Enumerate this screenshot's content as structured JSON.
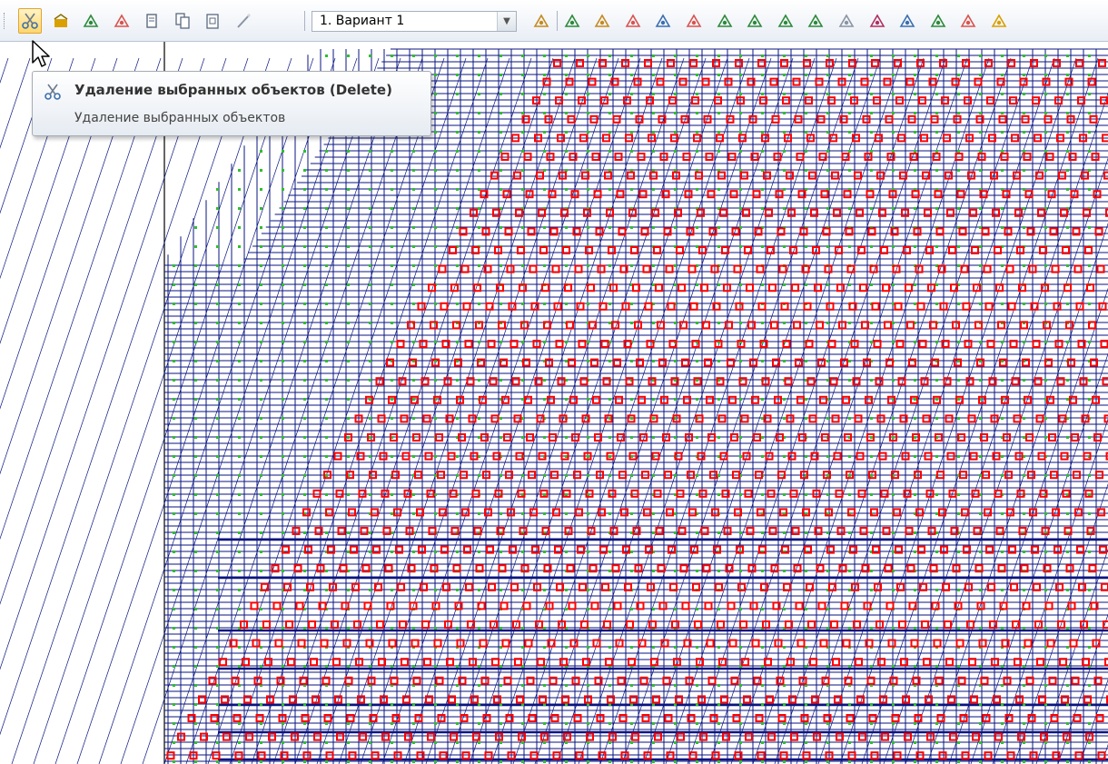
{
  "toolbar": {
    "left_buttons": [
      {
        "icon": "scissors-icon",
        "color": "#3a6fb0",
        "active": true
      },
      {
        "icon": "open-box-icon",
        "color": "#d9a000"
      },
      {
        "icon": "pin-nodes-icon",
        "color": "#2c8a3a"
      },
      {
        "icon": "add-node-icon",
        "color": "#d9534f"
      },
      {
        "icon": "copy-doc-icon",
        "color": "#5a6a80"
      },
      {
        "icon": "copy-docs-icon",
        "color": "#5a6a80"
      },
      {
        "icon": "paste-doc-icon",
        "color": "#5a6a80"
      },
      {
        "icon": "wand-icon",
        "color": "#8a94a3"
      }
    ],
    "variant_select": {
      "value": "1. Вариант 1"
    },
    "right_buttons": [
      {
        "icon": "hammer-icon",
        "color": "#c58a1f"
      },
      {
        "icon": "supports-icon",
        "color": "#2c8a3a"
      },
      {
        "icon": "loads-icon",
        "color": "#c58a1f"
      },
      {
        "icon": "spring-grid-icon",
        "color": "#d9534f"
      },
      {
        "icon": "table-icon",
        "color": "#3a6fb0"
      },
      {
        "icon": "eraser-icon",
        "color": "#d9534f"
      },
      {
        "icon": "rotate-axes-icon",
        "color": "#2c8a3a"
      },
      {
        "icon": "hatch-icon",
        "color": "#2c8a3a"
      },
      {
        "icon": "split-icon",
        "color": "#2c8a3a"
      },
      {
        "icon": "swirl-icon",
        "color": "#2c8a3a"
      },
      {
        "icon": "tool-icon",
        "color": "#8a94a3"
      },
      {
        "icon": "stack-icon",
        "color": "#b03060"
      },
      {
        "icon": "hinge-icon",
        "color": "#3a6fb0"
      },
      {
        "icon": "label-axes-icon",
        "color": "#2c8a3a"
      },
      {
        "icon": "frame-icon",
        "color": "#d9534f"
      },
      {
        "icon": "grid-color-icon",
        "color": "#d9a000"
      }
    ]
  },
  "model_view": {
    "colors": {
      "background": "#ffffff",
      "mesh": "#0a1580",
      "node": "#2fbf2f",
      "marker": "#ff0000",
      "frame": "#000000"
    }
  },
  "tooltip": {
    "title": "Удаление выбранных объектов (Delete)",
    "description": "Удаление выбранных объектов",
    "icon": "scissors-icon"
  }
}
